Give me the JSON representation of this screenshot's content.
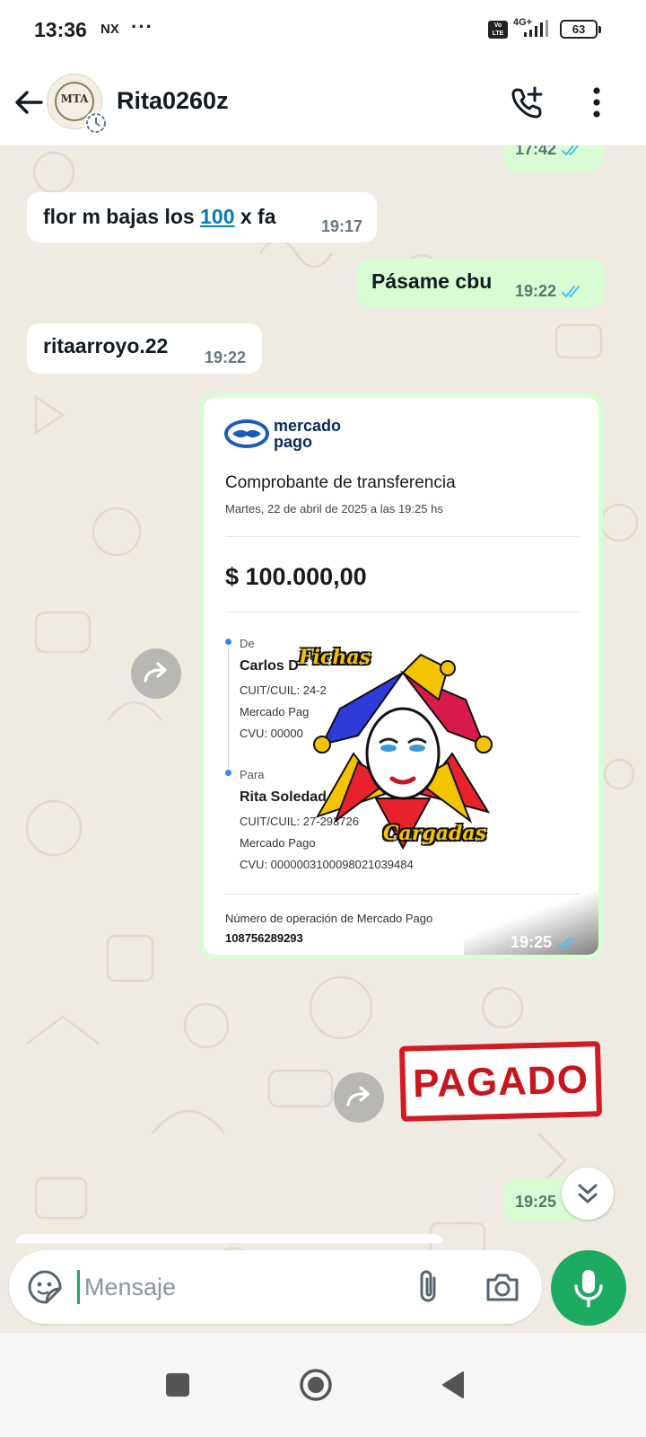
{
  "status_bar": {
    "time": "13:36",
    "carrier": "NX",
    "overflow": "···",
    "volte": "Vo LTE",
    "network": "4G+",
    "battery": "63"
  },
  "header": {
    "contact_name": "Rita0260z",
    "avatar_text": "MTA",
    "icons": [
      "back-arrow-icon",
      "add-call-icon",
      "more-vert-icon"
    ]
  },
  "messages": [
    {
      "direction": "out",
      "text": "",
      "time": "17:42",
      "read": true
    },
    {
      "direction": "in",
      "text_before": "flor m bajas los ",
      "link": "100",
      "text_after": " x fa",
      "time": "19:17"
    },
    {
      "direction": "out",
      "text": "Pásame cbu",
      "time": "19:22",
      "read": true
    },
    {
      "direction": "in",
      "text": "ritaarroyo.22",
      "time": "19:22"
    },
    {
      "direction": "out",
      "type": "image",
      "time": "19:25",
      "read": true
    },
    {
      "direction": "out",
      "type": "sticker",
      "text": "PAGADO"
    },
    {
      "direction": "out",
      "text": "",
      "time": "19:25"
    }
  ],
  "receipt": {
    "brand_line1": "mercado",
    "brand_line2": "pago",
    "title": "Comprobante de transferencia",
    "date": "Martes, 22 de abril de 2025 a las 19:25 hs",
    "amount": "$ 100.000,00",
    "from_label": "De",
    "from_name": "Carlos D",
    "from_cuit": "CUIT/CUIL: 24-2",
    "from_bank": "Mercado Pag",
    "from_cvu": "CVU: 00000",
    "to_label": "Para",
    "to_name": "Rita Soledad Arro",
    "to_cuit": "CUIT/CUIL: 27-293726",
    "to_bank": "Mercado Pago",
    "to_cvu": "CVU: 0000003100098021039484",
    "op_label": "Número de operación de Mercado Pago",
    "op_number": "108756289293",
    "sticker_top": "Fichas",
    "sticker_bottom": "Cargadas"
  },
  "composer": {
    "placeholder": "Mensaje"
  },
  "colors": {
    "accent": "#1daa61",
    "bubble_out": "#d9fdd3",
    "bubble_in": "#ffffff",
    "chat_bg": "#efeae2",
    "read_ticks": "#53bdeb",
    "pagado_red": "#c8161f"
  }
}
